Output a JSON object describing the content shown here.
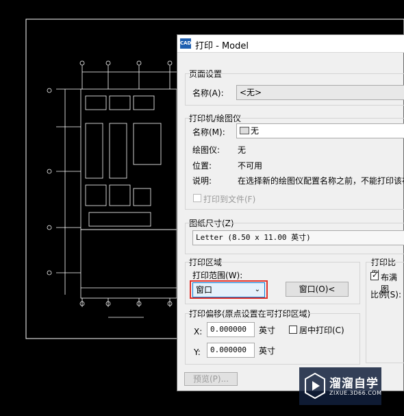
{
  "dialog": {
    "title": "打印 - Model",
    "page_setup": {
      "group": "页面设置",
      "name_label": "名称(A):",
      "name_value": "<无>"
    },
    "printer": {
      "group": "打印机/绘图仪",
      "name_label": "名称(M):",
      "name_value": "无",
      "plotter_label": "绘图仪:",
      "plotter_value": "无",
      "location_label": "位置:",
      "location_value": "不可用",
      "desc_label": "说明:",
      "desc_value": "在选择新的绘图仪配置名称之前，不能打印该布",
      "print_to_file": "打印到文件(F)"
    },
    "paper": {
      "group": "图纸尺寸(Z)",
      "value": "Letter (8.50 x 11.00 英寸)"
    },
    "area": {
      "group": "打印区域",
      "range_label": "打印范围(W):",
      "range_value": "窗口",
      "window_button": "窗口(O)<"
    },
    "offset": {
      "group": "打印偏移(原点设置在可打印区域)",
      "x_label": "X:",
      "x_value": "0.000000",
      "x_unit": "英寸",
      "center_label": "居中打印(C)",
      "y_label": "Y:",
      "y_value": "0.000000",
      "y_unit": "英寸"
    },
    "scale": {
      "group": "打印比例",
      "fit_label": "布满图",
      "ratio_label": "比例(S):"
    },
    "preview_button": "预览(P)..."
  },
  "watermark": {
    "brand": "溜溜自学",
    "url": "ZIXUE.3D66.COM"
  },
  "colors": {
    "cad_line": "#ffffff",
    "highlight": "#e0302a",
    "dialog_bg": "#f0f0f0"
  }
}
